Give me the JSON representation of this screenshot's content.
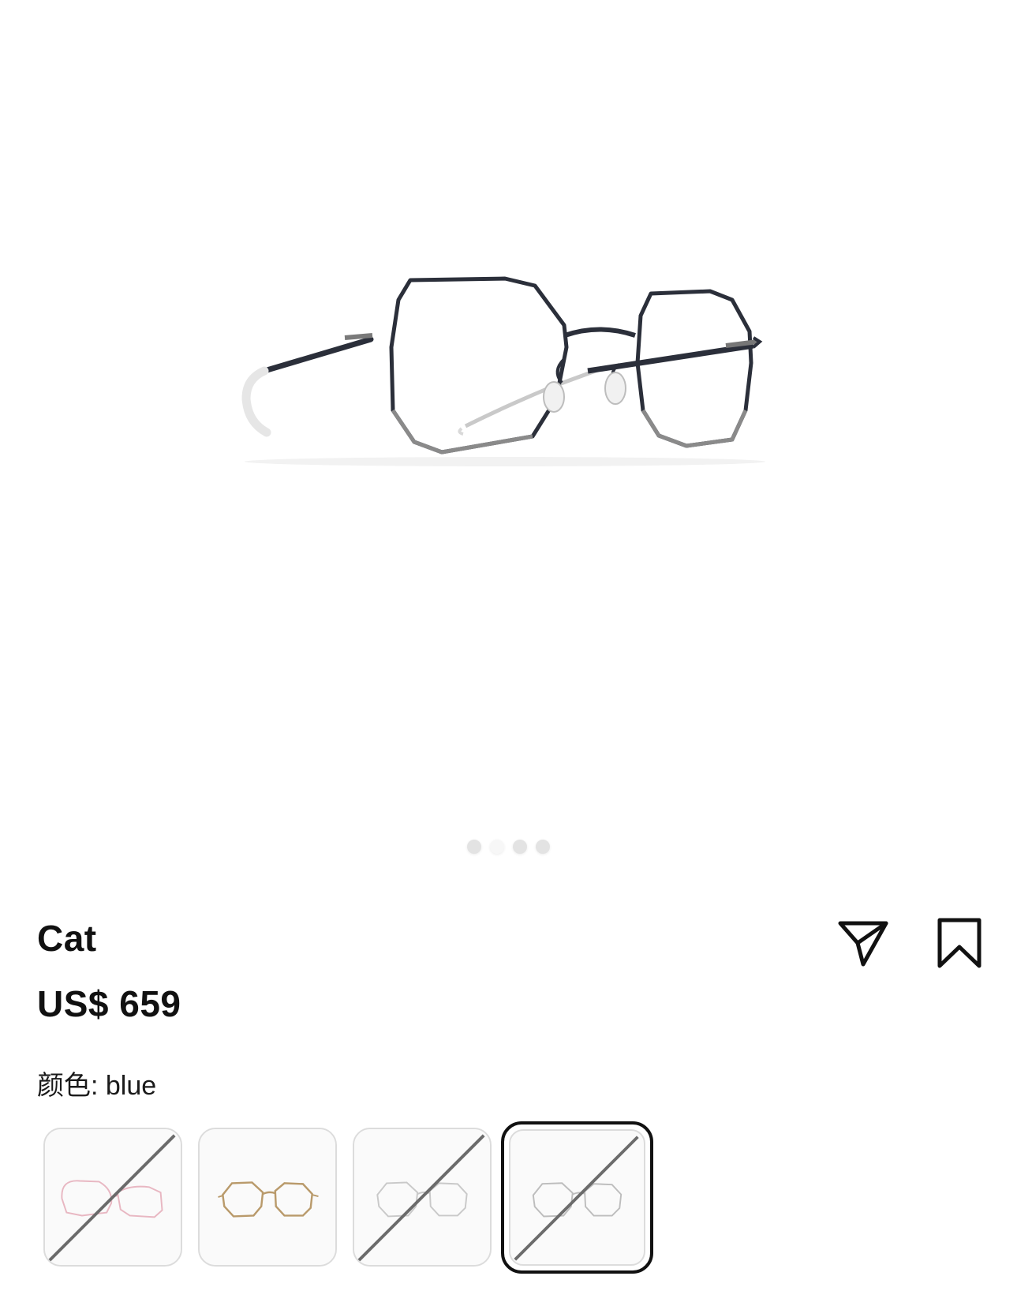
{
  "product": {
    "name": "Cat",
    "price": "US$ 659",
    "color_label": "颜色: blue",
    "image_icon": "eyeglasses-frame-image"
  },
  "carousel": {
    "total": 4,
    "active_index": 1
  },
  "actions": {
    "share_icon": "paper-plane-icon",
    "bookmark_icon": "bookmark-icon"
  },
  "color_options": [
    {
      "name": "pink",
      "frame_color": "#e8b7c2",
      "available": false,
      "selected": false
    },
    {
      "name": "gold",
      "frame_color": "#b99a6b",
      "available": true,
      "selected": false
    },
    {
      "name": "silver",
      "frame_color": "#c9c9c9",
      "available": false,
      "selected": false
    },
    {
      "name": "blue",
      "frame_color": "#bdbdbd",
      "available": false,
      "selected": true
    }
  ],
  "colors": {
    "text": "#111111",
    "frame_main": "#2b2f3a",
    "selected_border": "#111111",
    "unavailable_slash": "#6b6b6b"
  }
}
